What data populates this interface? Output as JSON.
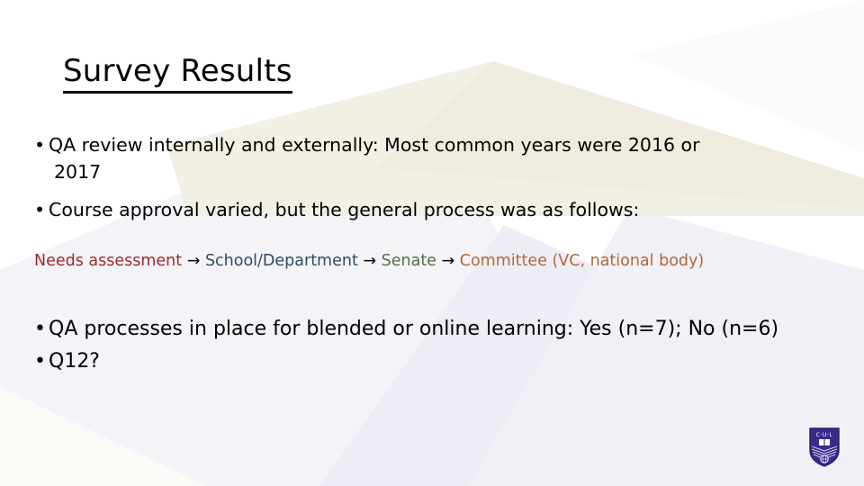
{
  "slide": {
    "title": "Survey Results",
    "background_color": "#FFFFFF",
    "decor": {
      "beige": "#F2EFE6",
      "lavender": "#E8E9F3",
      "lavender_soft": "#EFEFF6"
    }
  },
  "bullets_top": [
    {
      "bullet": "•",
      "line1": "QA review internally and externally: Most common years were 2016 or",
      "line2": "2017"
    },
    {
      "bullet": "•",
      "line1": "Course approval varied, but the general process was as follows:",
      "line2": ""
    }
  ],
  "flow": {
    "steps": [
      {
        "label": "Needs assessment",
        "color": "#9E2A2B"
      },
      {
        "label": "School/Department",
        "color": "#2E4C63"
      },
      {
        "label": "Senate",
        "color": "#53703F"
      },
      {
        "label": "Committee (VC, national body)",
        "color": "#B06A35"
      }
    ],
    "arrow": "→",
    "arrow_color": "#000000"
  },
  "bullets_bottom": [
    {
      "bullet": "•",
      "text": "QA processes in place for blended or online learning: Yes (n=7); No (n=6)"
    },
    {
      "bullet": "•",
      "text": "Q12?"
    }
  ],
  "logo": {
    "name": "university-crest-logo",
    "motto_letters": "C·U·L",
    "shield_color": "#3B2A8C"
  }
}
